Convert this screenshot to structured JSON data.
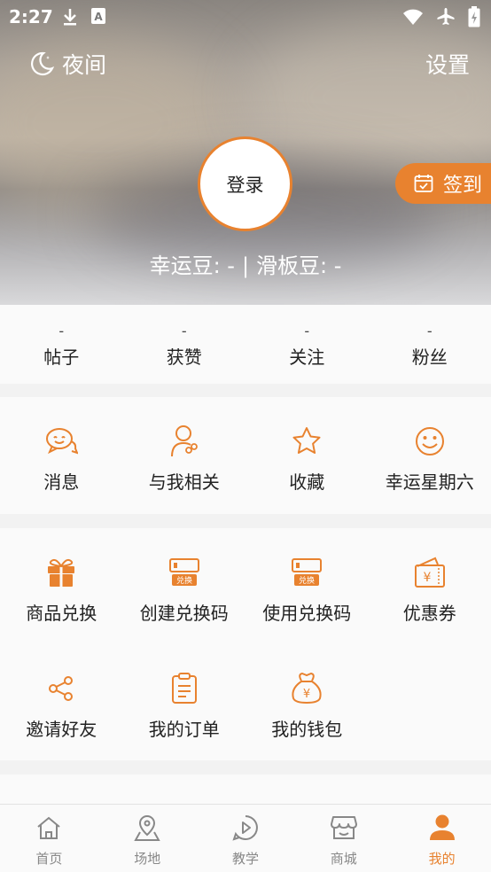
{
  "status_bar": {
    "time": "2:27"
  },
  "header": {
    "night_label": "夜间",
    "settings_label": "设置",
    "login_label": "登录",
    "signin_label": "签到",
    "lucky_beans": "幸运豆: -",
    "separator": "|",
    "skate_beans": "滑板豆: -"
  },
  "stats": [
    {
      "value": "-",
      "label": "帖子"
    },
    {
      "value": "-",
      "label": "获赞"
    },
    {
      "value": "-",
      "label": "关注"
    },
    {
      "value": "-",
      "label": "粉丝"
    }
  ],
  "section1": [
    {
      "icon": "message-icon",
      "label": "消息"
    },
    {
      "icon": "related-user-icon",
      "label": "与我相关"
    },
    {
      "icon": "star-icon",
      "label": "收藏"
    },
    {
      "icon": "smile-icon",
      "label": "幸运星期六"
    }
  ],
  "section2": [
    {
      "icon": "gift-icon",
      "label": "商品兑换"
    },
    {
      "icon": "exchange-code-icon",
      "label": "创建兑换码",
      "badge": "兑换"
    },
    {
      "icon": "exchange-code-icon",
      "label": "使用兑换码",
      "badge": "兑换"
    },
    {
      "icon": "coupon-icon",
      "label": "优惠券"
    },
    {
      "icon": "share-icon",
      "label": "邀请好友"
    },
    {
      "icon": "order-icon",
      "label": "我的订单"
    },
    {
      "icon": "wallet-bag-icon",
      "label": "我的钱包"
    }
  ],
  "bottom_nav": [
    {
      "icon": "home-icon",
      "label": "首页",
      "active": false
    },
    {
      "icon": "location-icon",
      "label": "场地",
      "active": false
    },
    {
      "icon": "play-icon",
      "label": "教学",
      "active": false
    },
    {
      "icon": "store-icon",
      "label": "商城",
      "active": false
    },
    {
      "icon": "person-icon",
      "label": "我的",
      "active": true
    }
  ],
  "colors": {
    "accent": "#e8822f",
    "inactive": "#888888"
  }
}
